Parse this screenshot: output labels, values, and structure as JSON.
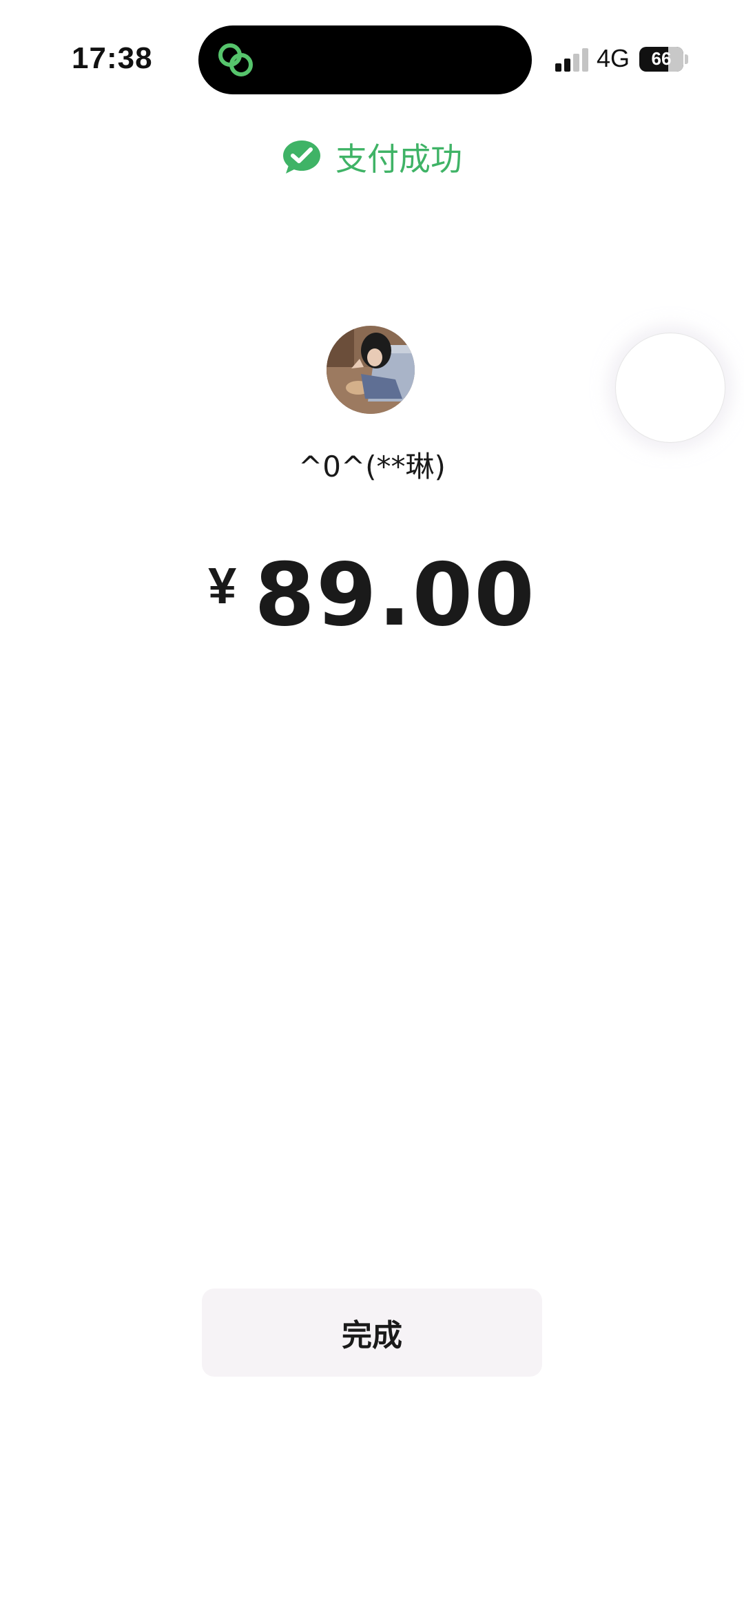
{
  "status_bar": {
    "time": "17:38",
    "network": "4G",
    "battery": "66",
    "battery_level": 0.66
  },
  "header": {
    "title": "支付成功",
    "accent_color": "#3fb366"
  },
  "payee": {
    "name": "^0^(**琳)"
  },
  "payment": {
    "currency_symbol": "¥",
    "amount": "89.00"
  },
  "actions": {
    "done_label": "完成"
  },
  "icons": {
    "island": "link-rings-icon",
    "title": "wechat-chat-check-icon"
  }
}
